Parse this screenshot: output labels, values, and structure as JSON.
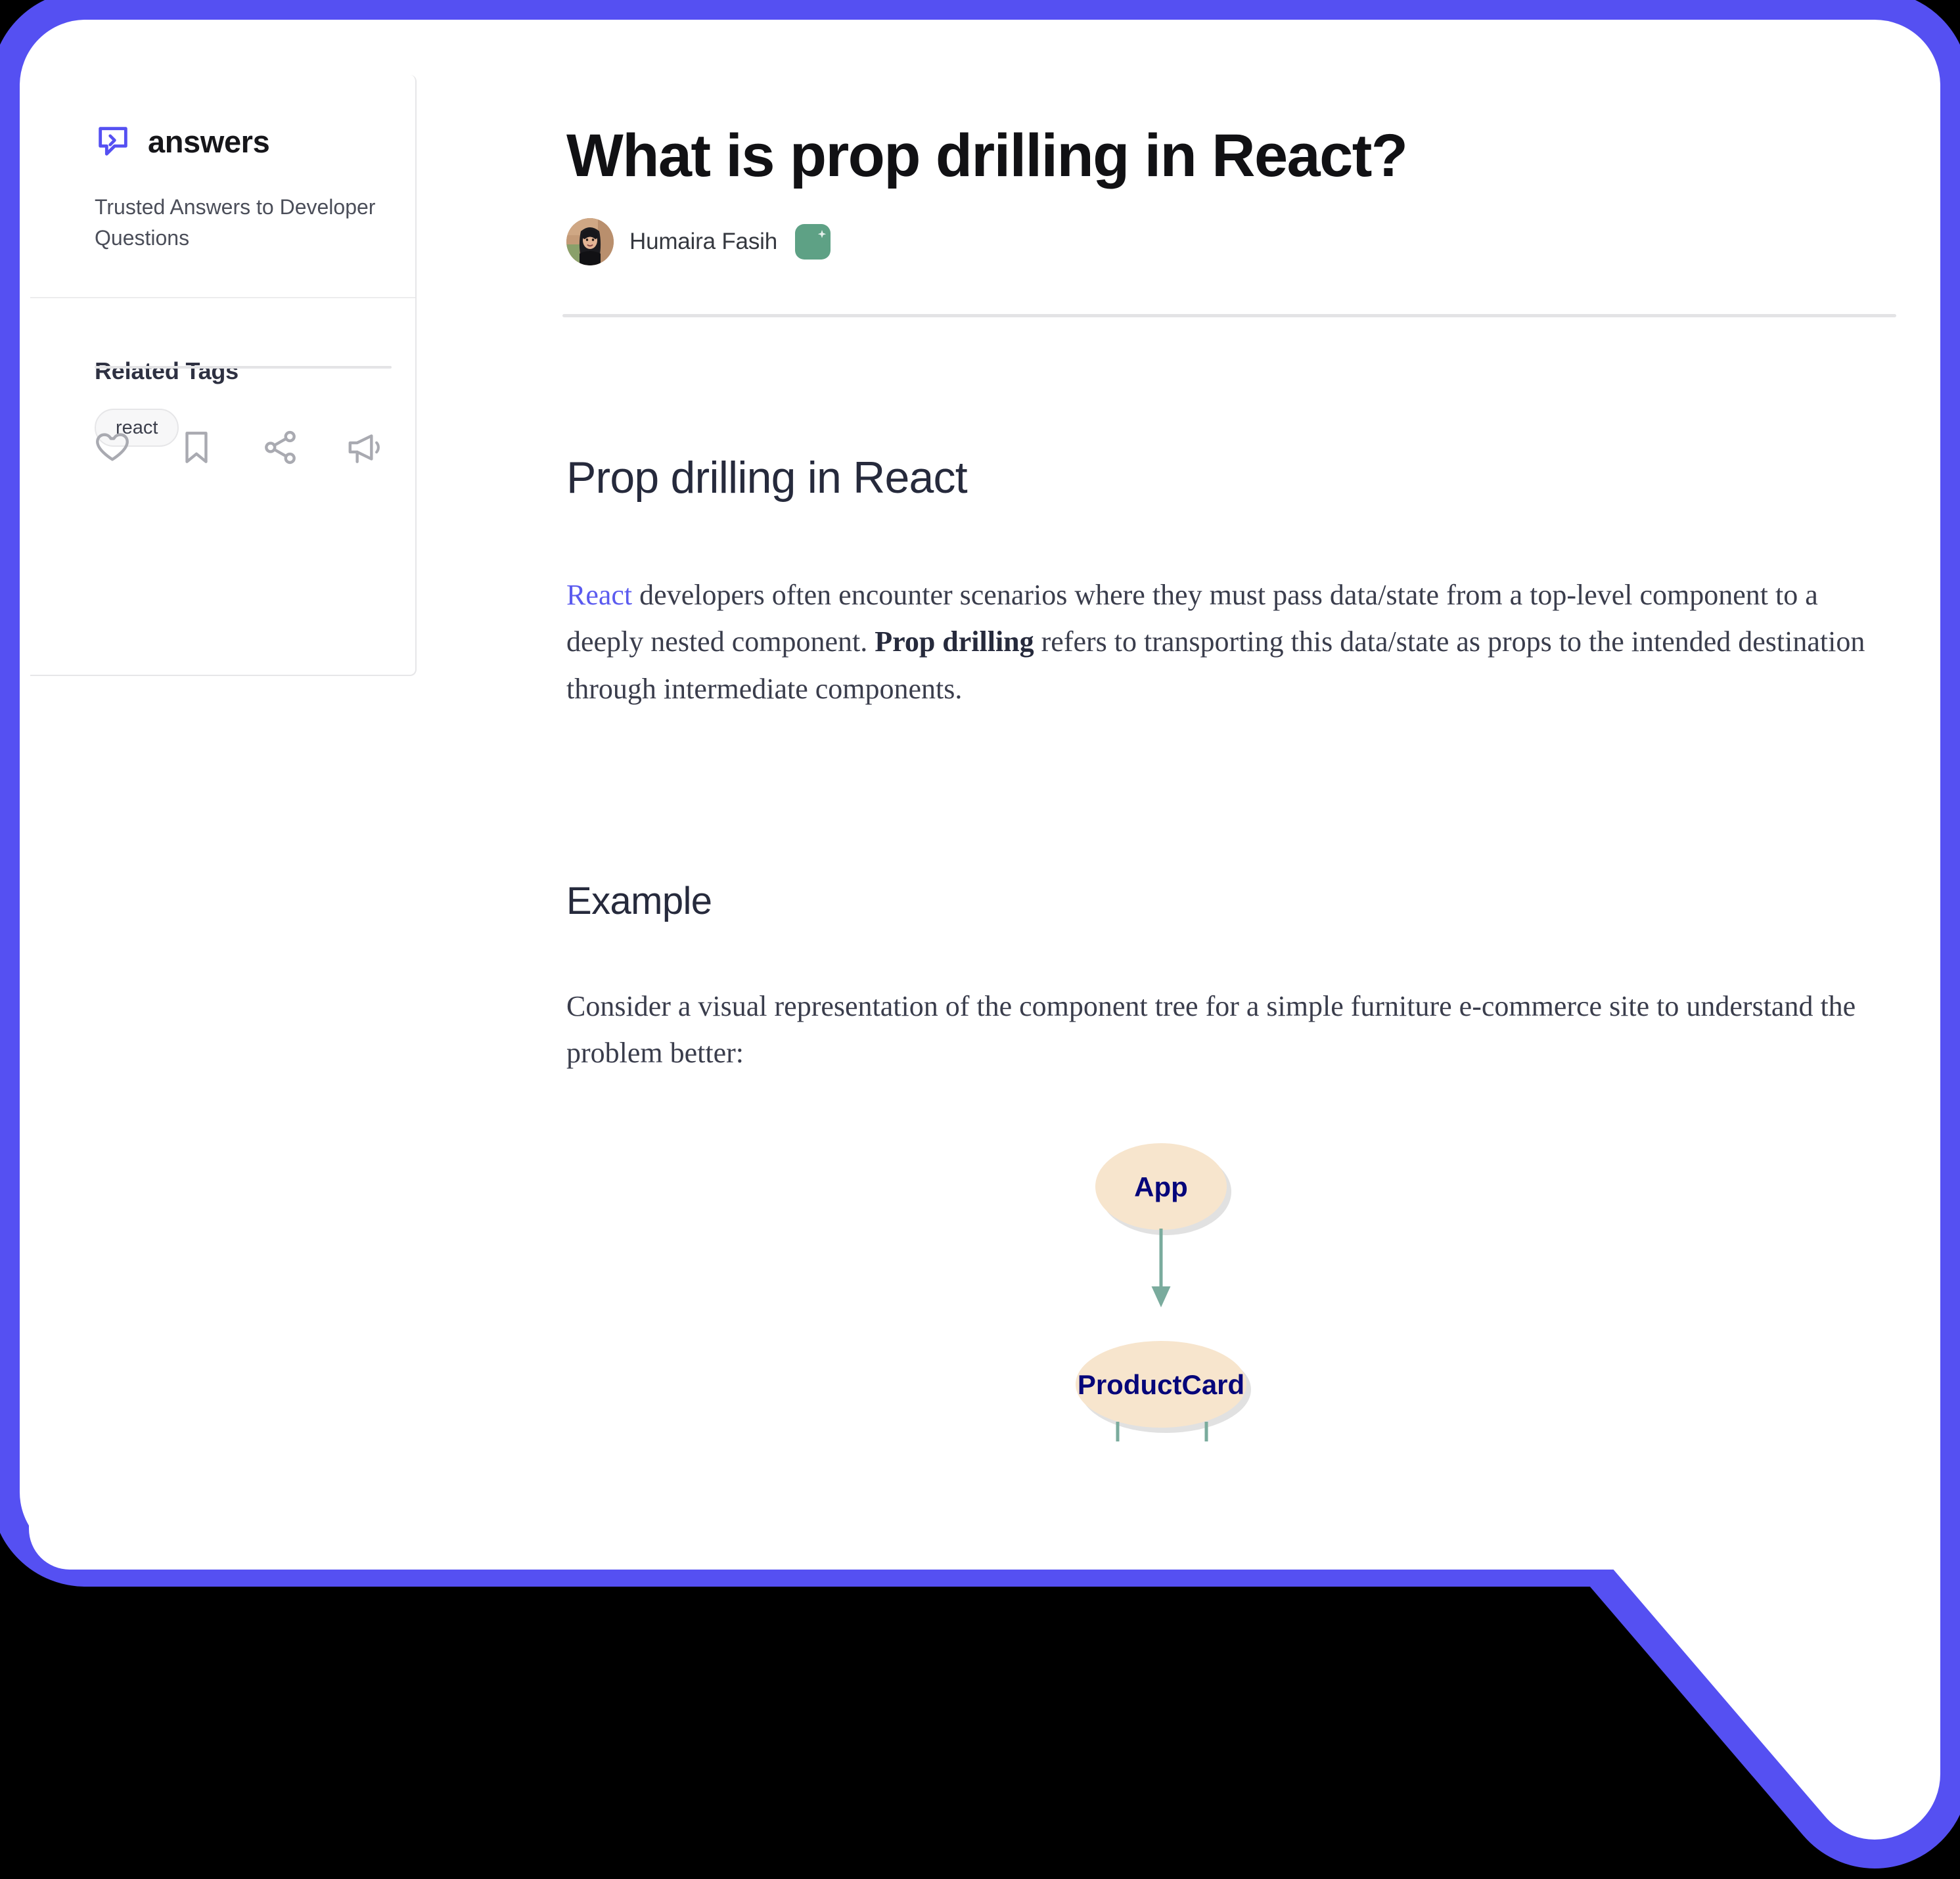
{
  "theme": {
    "bubble_border": "#5550F2",
    "page_bg": "#ffffff",
    "link": "#5b5bef",
    "heading": "#262a3c",
    "body_text": "#3a3d4c",
    "badge_green": "#5ea185",
    "node_fill": "#f7e5cd",
    "node_text": "#06067a",
    "edge": "#7aab9d"
  },
  "sidebar": {
    "brand": {
      "icon": "chat-code-icon",
      "name": "answers",
      "tagline": "Trusted Answers to Developer Questions"
    },
    "related_tags": {
      "title": "Related Tags",
      "tags": [
        "react"
      ]
    },
    "actions": [
      {
        "name": "like-icon",
        "label": "Like"
      },
      {
        "name": "bookmark-icon",
        "label": "Bookmark"
      },
      {
        "name": "share-icon",
        "label": "Share"
      },
      {
        "name": "report-icon",
        "label": "Report"
      }
    ]
  },
  "article": {
    "title": "What is prop drilling in React?",
    "author": {
      "name": "Humaira Fasih",
      "avatar": "author-avatar",
      "badge": "verified-badge"
    },
    "heading_2": "Prop drilling in React",
    "paragraph_1": {
      "link_text": "React",
      "segment_1": " developers often encounter scenarios where they must pass data/state from a top-level component to a deeply nested component. ",
      "bold_text": "Prop drilling",
      "segment_2": " refers to transporting this data/state as props to the intended destination through intermediate components."
    },
    "heading_3": "Example",
    "paragraph_2": "Consider a visual representation of the component tree for a simple furniture e-commerce site to understand the problem better:"
  },
  "diagram": {
    "type": "tree",
    "nodes": [
      {
        "id": "app",
        "label": "App"
      },
      {
        "id": "productcard",
        "label": "ProductCard"
      }
    ],
    "edges": [
      {
        "from": "app",
        "to": "productcard"
      }
    ]
  }
}
